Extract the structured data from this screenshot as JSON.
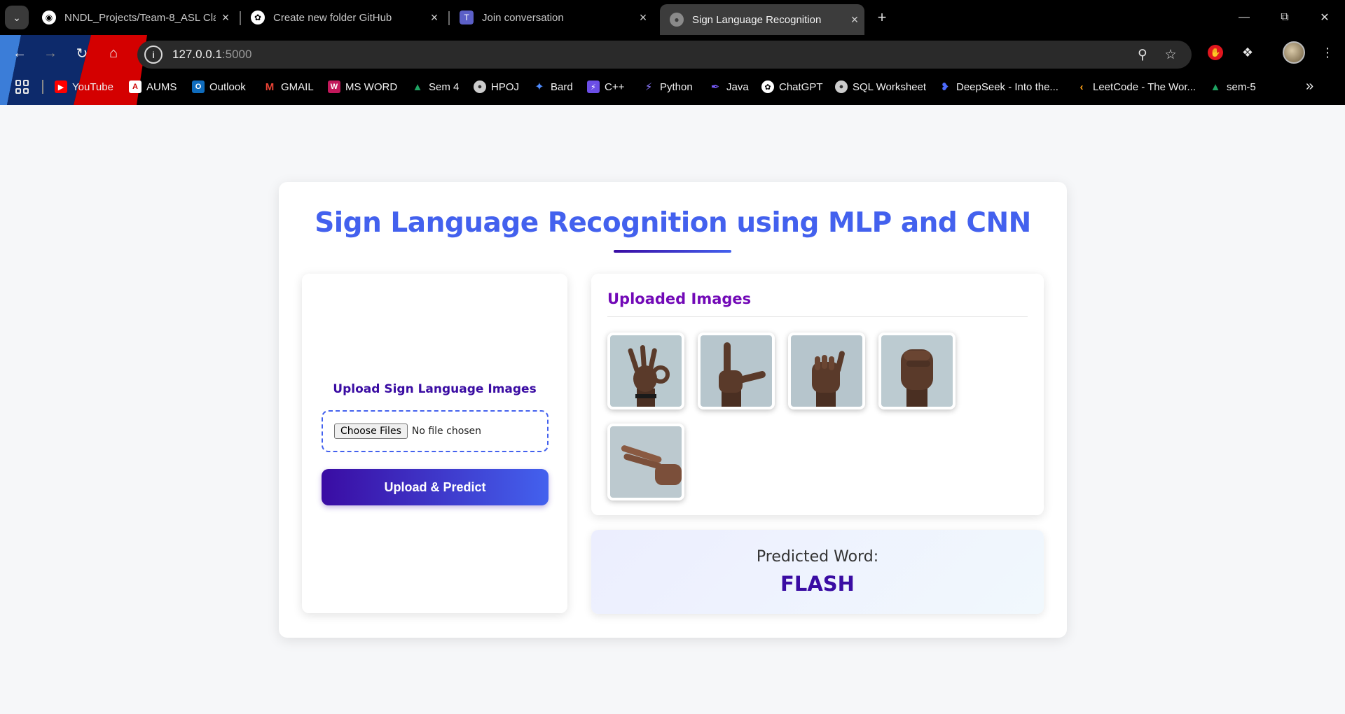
{
  "browser": {
    "tabs": [
      {
        "title": "NNDL_Projects/Team-8_ASL Cla",
        "favicon": "github-icon"
      },
      {
        "title": "Create new folder GitHub",
        "favicon": "openai-icon"
      },
      {
        "title": "Join conversation",
        "favicon": "teams-icon"
      },
      {
        "title": "Sign Language Recognition",
        "favicon": "globe-icon"
      }
    ],
    "url_host": "127.0.0.1",
    "url_port": ":5000",
    "bookmarks": [
      {
        "label": "YouTube",
        "icon": "youtube-icon",
        "color": "#ff0000"
      },
      {
        "label": "AUMS",
        "icon": "aums-icon",
        "color": "#ffffff"
      },
      {
        "label": "Outlook",
        "icon": "outlook-icon",
        "color": "#0f6cbd"
      },
      {
        "label": "GMAIL",
        "icon": "gmail-icon",
        "color": "#ea4335"
      },
      {
        "label": "MS WORD",
        "icon": "word-icon",
        "color": "#c2185b"
      },
      {
        "label": "Sem 4",
        "icon": "drive-icon",
        "color": "#1fa463"
      },
      {
        "label": "HPOJ",
        "icon": "globe-icon",
        "color": "#cccccc"
      },
      {
        "label": "Bard",
        "icon": "bard-icon",
        "color": "#4f8cff"
      },
      {
        "label": "C++",
        "icon": "bolt-icon",
        "color": "#6b4ee6"
      },
      {
        "label": "Python",
        "icon": "bolt-icon",
        "color": "#6b4ee6"
      },
      {
        "label": "Java",
        "icon": "pen-icon",
        "color": "#7a5cff"
      },
      {
        "label": "ChatGPT",
        "icon": "openai-icon",
        "color": "#ffffff"
      },
      {
        "label": "SQL Worksheet",
        "icon": "globe-icon",
        "color": "#cccccc"
      },
      {
        "label": "DeepSeek - Into the...",
        "icon": "deepseek-icon",
        "color": "#4d6bfe"
      },
      {
        "label": "LeetCode - The Wor...",
        "icon": "leetcode-icon",
        "color": "#ffa116"
      },
      {
        "label": "sem-5",
        "icon": "drive-icon",
        "color": "#1fa463"
      }
    ]
  },
  "page": {
    "title": "Sign Language Recognition using MLP and CNN",
    "upload": {
      "label": "Upload Sign Language Images",
      "choose_button": "Choose Files",
      "file_status": "No file chosen",
      "submit_button": "Upload & Predict"
    },
    "uploaded": {
      "heading": "Uploaded Images",
      "images": [
        {
          "alt": "sign-f"
        },
        {
          "alt": "sign-l"
        },
        {
          "alt": "sign-a"
        },
        {
          "alt": "sign-s"
        },
        {
          "alt": "sign-h"
        }
      ]
    },
    "result": {
      "label": "Predicted Word:",
      "word": "FLASH"
    }
  },
  "colors": {
    "accent": "#4361ee",
    "accent_dark": "#3a0ca3",
    "heading_purple": "#7209b7"
  }
}
